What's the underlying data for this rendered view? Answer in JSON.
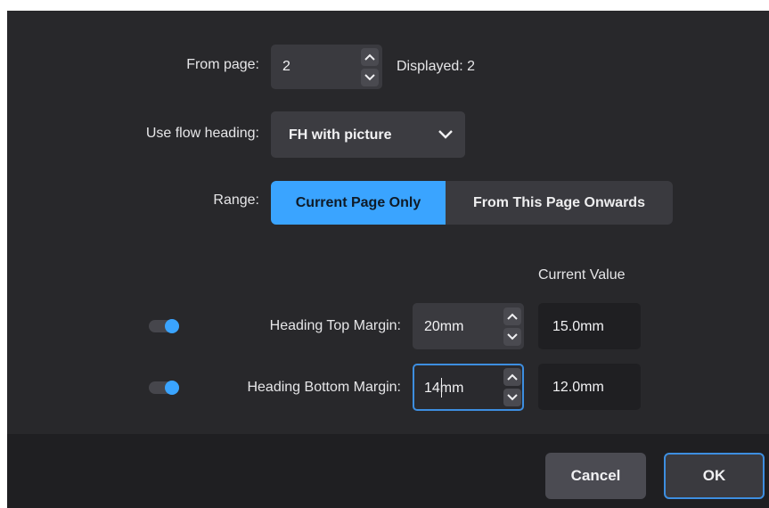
{
  "from_page": {
    "label": "From page:",
    "value": "2",
    "displayed": "Displayed: 2"
  },
  "flow_heading": {
    "label": "Use flow heading:",
    "selected": "FH with picture"
  },
  "range": {
    "label": "Range:",
    "options": [
      "Current Page Only",
      "From This Page Onwards"
    ],
    "selected": "Current Page Only"
  },
  "margins": {
    "current_value_header": "Current Value",
    "top": {
      "label": "Heading Top Margin:",
      "value": "20mm",
      "current": "15.0mm",
      "enabled": true
    },
    "bottom": {
      "label": "Heading Bottom Margin:",
      "value": "14mm",
      "current": "12.0mm",
      "enabled": true
    }
  },
  "buttons": {
    "cancel": "Cancel",
    "ok": "OK"
  },
  "colors": {
    "accent": "#3aa4ff",
    "focus_border": "#3d8ee0",
    "dialog_bg": "#28282b",
    "footer_bg": "#1f1f22"
  },
  "icons": [
    "chevron-up-icon",
    "chevron-down-icon",
    "dropdown-chevron-icon",
    "toggle-switch"
  ]
}
